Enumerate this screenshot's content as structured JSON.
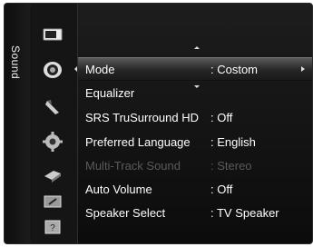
{
  "sidebar": {
    "label": "Sound"
  },
  "icons": [
    "picture-icon",
    "sound-icon",
    "channel-icon",
    "setup-icon",
    "input-icon",
    "application-icon",
    "support-icon"
  ],
  "support_icon_glyph": "?",
  "menu": {
    "items": [
      {
        "label": "Mode",
        "value": ": Costom",
        "selected": true,
        "enabled": true
      },
      {
        "label": "Equalizer",
        "value": "",
        "selected": false,
        "enabled": true
      },
      {
        "label": "SRS TruSurround HD",
        "value": ": Off",
        "selected": false,
        "enabled": true
      },
      {
        "label": "Preferred Language",
        "value": ": English",
        "selected": false,
        "enabled": true
      },
      {
        "label": "Multi-Track Sound",
        "value": ": Stereo",
        "selected": false,
        "enabled": false
      },
      {
        "label": "Auto Volume",
        "value": ": Off",
        "selected": false,
        "enabled": true
      },
      {
        "label": "Speaker Select",
        "value": ": TV Speaker",
        "selected": false,
        "enabled": true
      }
    ]
  }
}
